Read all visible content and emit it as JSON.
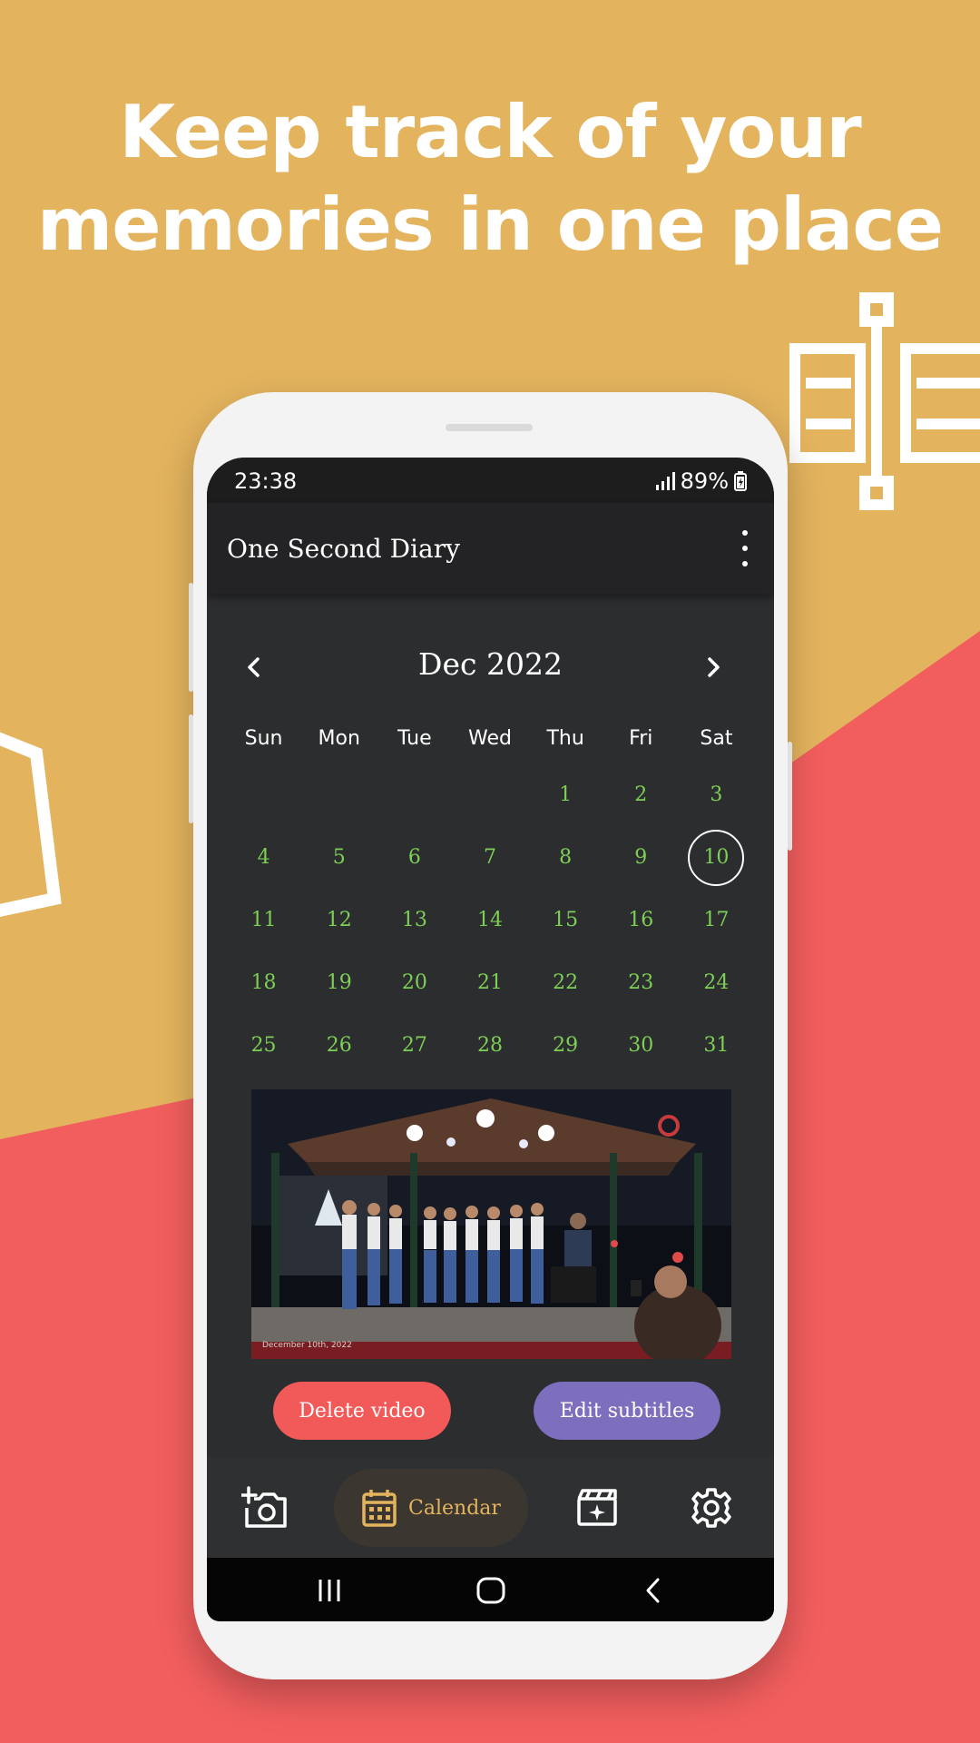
{
  "promo": {
    "headline_line1": "Keep track of your",
    "headline_line2": "memories in one place"
  },
  "colors": {
    "background_top": "#E3B35E",
    "background_bottom": "#F25E5E",
    "accent_green": "#7DCF55",
    "accent_gold": "#E3B35E",
    "delete_red": "#F25A5A",
    "edit_purple": "#7E6EBE"
  },
  "status_bar": {
    "time": "23:38",
    "battery": "89%"
  },
  "app_bar": {
    "title": "One Second Diary",
    "menu_icon": "more-vert-icon"
  },
  "calendar": {
    "month_label": "Dec 2022",
    "weekdays": [
      "Sun",
      "Mon",
      "Tue",
      "Wed",
      "Thu",
      "Fri",
      "Sat"
    ],
    "leading_empty": 4,
    "days": [
      "1",
      "2",
      "3",
      "4",
      "5",
      "6",
      "7",
      "8",
      "9",
      "10",
      "11",
      "12",
      "13",
      "14",
      "15",
      "16",
      "17",
      "18",
      "19",
      "20",
      "21",
      "22",
      "23",
      "24",
      "25",
      "26",
      "27",
      "28",
      "29",
      "30",
      "31"
    ],
    "selected_day": "10"
  },
  "video": {
    "caption": "December 10th, 2022"
  },
  "actions": {
    "delete_label": "Delete video",
    "edit_label": "Edit subtitles"
  },
  "bottom_nav": {
    "items": [
      {
        "icon": "add-photo-icon",
        "label": ""
      },
      {
        "icon": "calendar-icon",
        "label": "Calendar",
        "active": true
      },
      {
        "icon": "movie-icon",
        "label": ""
      },
      {
        "icon": "settings-icon",
        "label": ""
      }
    ]
  }
}
